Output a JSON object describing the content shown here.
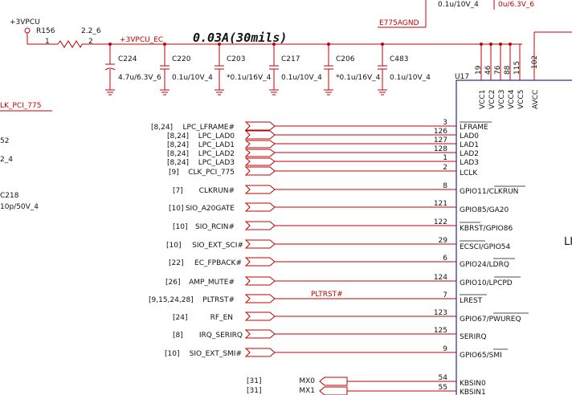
{
  "top_labels": {
    "power_net": "+3VPCU",
    "resistor_ref": "R156",
    "resistor_value": "2.2_6",
    "resistor_pin1": "1",
    "resistor_pin2": "2",
    "ec_net": "+3VPCU_EC",
    "current_note": "0.03A(30mils)",
    "agnd_net": "E775AGND",
    "top_cap_value_1": "0.1u/10V_4",
    "top_cap_value_2": "0u/6.3V_6"
  },
  "capacitors": [
    {
      "ref": "C224",
      "value": "4.7u/6.3V_6"
    },
    {
      "ref": "C220",
      "value": "0.1u/10V_4"
    },
    {
      "ref": "C203",
      "value": "*0.1u/16V_4"
    },
    {
      "ref": "C217",
      "value": "0.1u/10V_4"
    },
    {
      "ref": "C206",
      "value": "*0.1u/16V_4"
    },
    {
      "ref": "C483",
      "value": "0.1u/10V_4"
    }
  ],
  "ic": {
    "ref": "U17",
    "partial_label": "LI",
    "power_pins": [
      {
        "name": "VCC1",
        "num": "19"
      },
      {
        "name": "VCC2",
        "num": "46"
      },
      {
        "name": "VCC3",
        "num": "76"
      },
      {
        "name": "VCC4",
        "num": "88"
      },
      {
        "name": "VCC5",
        "num": "115"
      },
      {
        "name": "AVCC",
        "num": "102"
      }
    ]
  },
  "left_fragments": {
    "clk_net": "LK_PCI_775",
    "frag_1": "52",
    "frag_2": "2_4",
    "frag_3": "C218",
    "frag_4": "10p/50V_4"
  },
  "signals": [
    {
      "ref": "[8,24]",
      "net": "LPC_LFRAME#",
      "pin": "3",
      "pin_name": "LFRAME",
      "bar": true
    },
    {
      "ref": "[8,24]",
      "net": "LPC_LAD0",
      "pin": "126",
      "pin_name": "LAD0",
      "bar": false
    },
    {
      "ref": "[8,24]",
      "net": "LPC_LAD1",
      "pin": "127",
      "pin_name": "LAD1",
      "bar": false
    },
    {
      "ref": "[8,24]",
      "net": "LPC_LAD2",
      "pin": "128",
      "pin_name": "LAD2",
      "bar": false
    },
    {
      "ref": "[8,24]",
      "net": "LPC_LAD3",
      "pin": "1",
      "pin_name": "LAD3",
      "bar": false
    },
    {
      "ref": "[9]",
      "net": "CLK_PCI_775",
      "pin": "2",
      "pin_name": "LCLK",
      "bar": false
    },
    {
      "ref": "[7]",
      "net": "CLKRUN#",
      "pin": "8",
      "pin_name": "GPIO11/CLKRUN",
      "bar": false
    },
    {
      "ref": "[10]",
      "net": "SIO_A20GATE",
      "pin": "121",
      "pin_name": "GPIO85/GA20",
      "bar": false
    },
    {
      "ref": "[10]",
      "net": "SIO_RCIN#",
      "pin": "122",
      "pin_name": "KBRST/GPIO86",
      "bar": false
    },
    {
      "ref": "[10]",
      "net": "SIO_EXT_SCI#",
      "pin": "29",
      "pin_name": "ECSCI/GPIO54",
      "bar": false
    },
    {
      "ref": "[22]",
      "net": "EC_FPBACK#",
      "pin": "6",
      "pin_name": "GPIO24/LDRQ",
      "bar": false
    },
    {
      "ref": "[26]",
      "net": "AMP_MUTE#",
      "pin": "124",
      "pin_name": "GPIO10/LPCPD",
      "bar": false
    },
    {
      "ref": "[9,15,24,28]",
      "net": "PLTRST#",
      "pin": "7",
      "pin_name": "LREST",
      "bar": true
    },
    {
      "ref": "[24]",
      "net": "RF_EN",
      "pin": "123",
      "pin_name": "GPIO67/PWUREQ",
      "bar": false
    },
    {
      "ref": "[8]",
      "net": "IRQ_SERIRQ",
      "pin": "125",
      "pin_name": "SERIRQ",
      "bar": false
    },
    {
      "ref": "[10]",
      "net": "SIO_EXT_SMI#",
      "pin": "9",
      "pin_name": "GPIO65/SMI",
      "bar": false
    }
  ],
  "pltrst_wire_label": "PLTRST#",
  "kbs": [
    {
      "ref": "[31]",
      "net": "MX0",
      "pin": "54",
      "pin_name": "KBSIN0"
    },
    {
      "ref": "[31]",
      "net": "MX1",
      "pin": "55",
      "pin_name": "KBSIN1"
    }
  ],
  "colors": {
    "wire": "#c00000",
    "ic_body": "#000060",
    "text": "#111111"
  }
}
